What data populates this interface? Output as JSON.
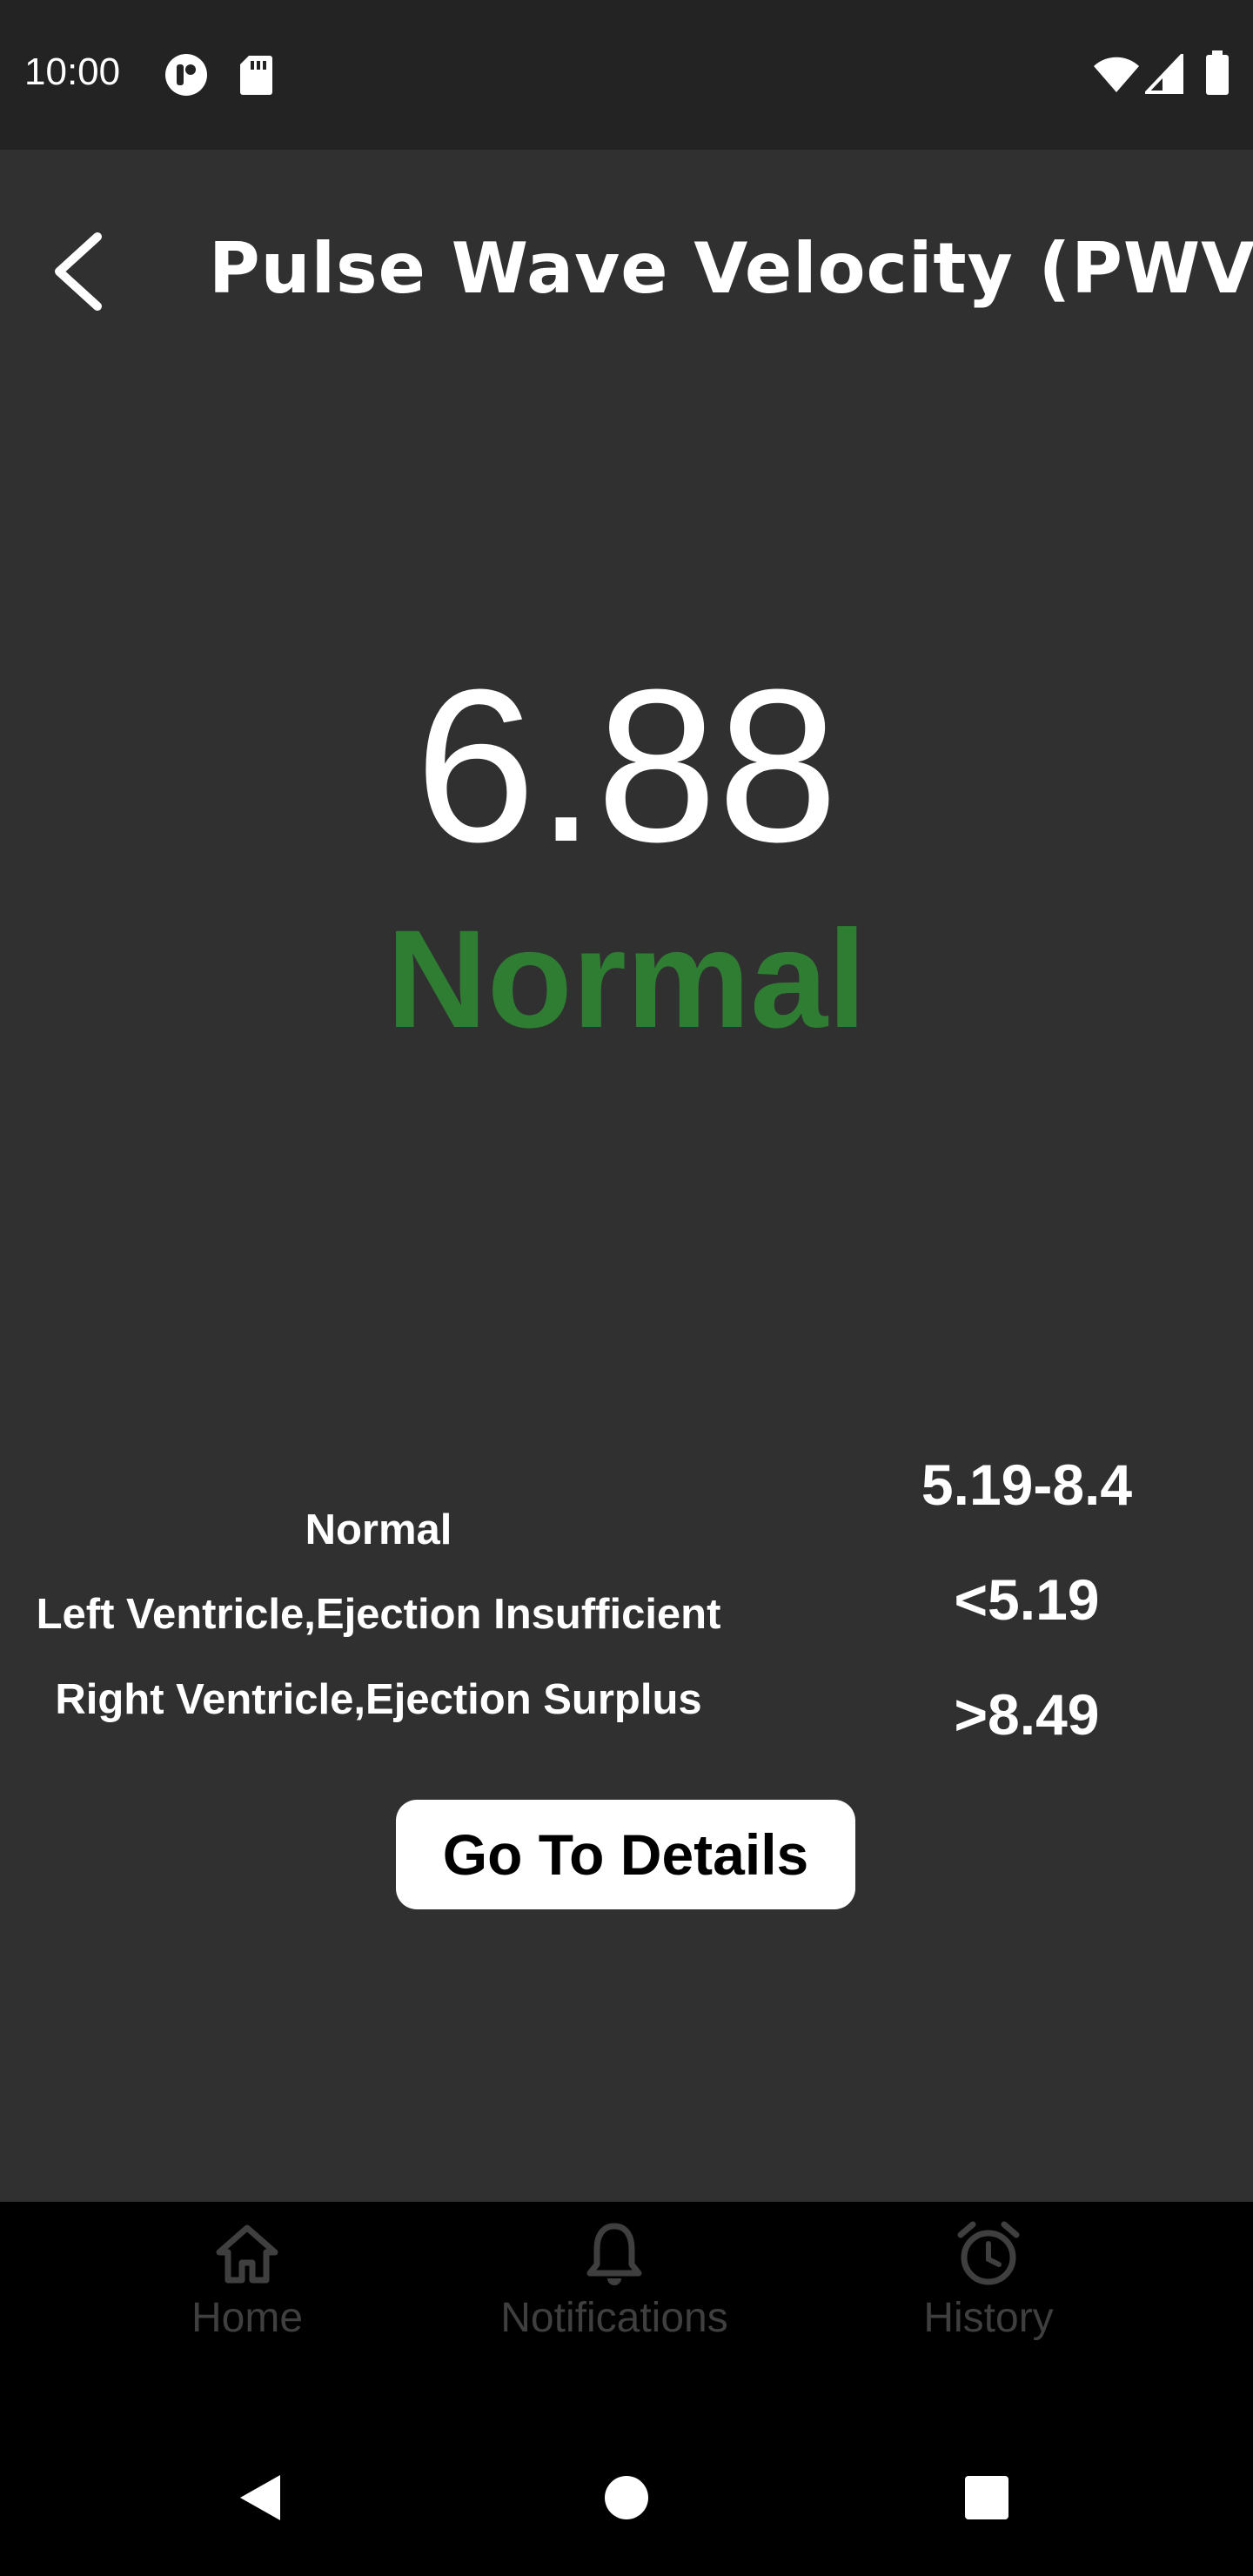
{
  "status_bar": {
    "time": "10:00",
    "icons": [
      "app-notification-icon",
      "sd-card-icon",
      "wifi-icon",
      "cell-signal-icon",
      "battery-icon"
    ]
  },
  "header": {
    "back_icon": "chevron-left-icon",
    "title": "Pulse Wave Velocity (PWV)"
  },
  "reading": {
    "value": "6.88",
    "status": "Normal",
    "status_color": "#2e7d32"
  },
  "ranges": [
    {
      "label": "Normal",
      "value": "5.19-8.4"
    },
    {
      "label": "Left Ventricle,Ejection Insufficient",
      "value": "<5.19"
    },
    {
      "label": "Right Ventricle,Ejection Surplus",
      "value": ">8.49"
    }
  ],
  "details_button": {
    "label": "Go To Details"
  },
  "bottom_nav": {
    "items": [
      {
        "label": "Home",
        "icon": "home-icon"
      },
      {
        "label": "Notifications",
        "icon": "bell-icon"
      },
      {
        "label": "History",
        "icon": "alarm-clock-icon"
      }
    ]
  },
  "system_nav": {
    "icons": [
      "back-triangle-icon",
      "home-circle-icon",
      "recents-square-icon"
    ]
  },
  "colors": {
    "background": "#303030",
    "status_bar": "#232323",
    "nav_background": "#000000",
    "nav_inactive": "#3f3f3f",
    "accent_normal": "#2e7d32"
  }
}
